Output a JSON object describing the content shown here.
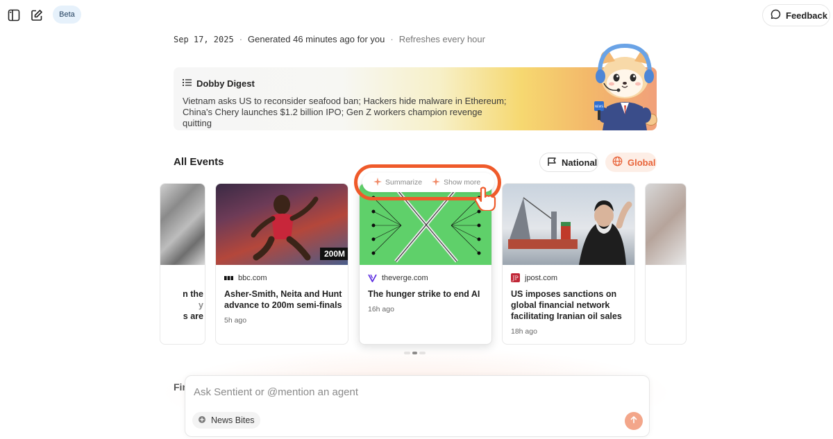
{
  "topbar": {
    "beta_label": "Beta",
    "feedback_label": "Feedback"
  },
  "meta": {
    "date": "Sep 17, 2025",
    "generated": "Generated 46 minutes ago for you",
    "refresh": "Refreshes every hour"
  },
  "digest": {
    "title": "Dobby Digest",
    "text": "Vietnam asks US to reconsider seafood ban; Hackers hide malware in Ethereum; China's Chery launches $1.2 billion IPO; Gen Z workers champion revenge quitting"
  },
  "events": {
    "title": "All Events",
    "filters": [
      {
        "label": "National",
        "active": false
      },
      {
        "label": "Global",
        "active": true
      }
    ],
    "partial_left": {
      "l1": "n the",
      "l2": "y",
      "l3": "s are"
    },
    "cards": [
      {
        "source": "bbc.com",
        "headline": "Asher-Smith, Neita and Hunt advance to 200m semi-finals",
        "time": "5h ago",
        "image_badge": "200M"
      },
      {
        "source": "theverge.com",
        "headline": "The hunger strike to end AI",
        "time": "16h ago"
      },
      {
        "source": "jpost.com",
        "headline": "US imposes sanctions on global financial network facilitating Iranian oil sales",
        "time": "18h ago"
      }
    ],
    "hover_actions": {
      "summarize": "Summarize",
      "show_more": "Show more"
    }
  },
  "bottom": {
    "section_partial": "Fin"
  },
  "composer": {
    "placeholder": "Ask Sentient or @mention an agent",
    "chip": "News Bites"
  },
  "colors": {
    "accent": "#ef5a2a",
    "global_pill_bg": "#fdeee6",
    "beta_bg": "#e6f1fb"
  }
}
